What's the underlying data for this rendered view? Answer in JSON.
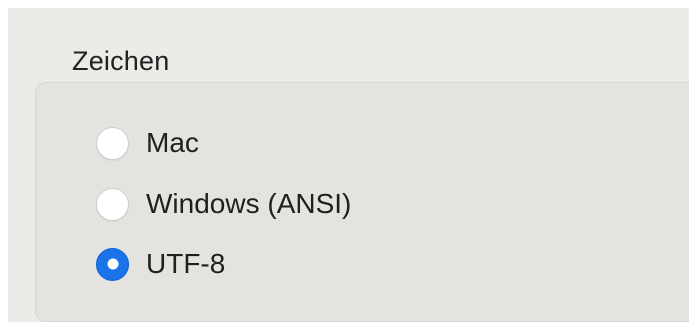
{
  "section": {
    "title": "Zeichen"
  },
  "encoding_options": [
    {
      "label": "Mac",
      "selected": false
    },
    {
      "label": "Windows (ANSI)",
      "selected": false
    },
    {
      "label": "UTF-8",
      "selected": true
    }
  ],
  "colors": {
    "accent": "#1a73e8",
    "window_background": "#ecebe8",
    "group_background": "#e4e3e0"
  }
}
